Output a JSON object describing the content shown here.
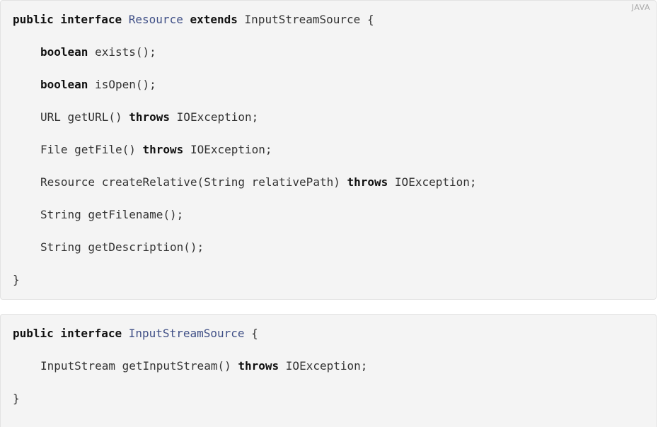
{
  "blocks": [
    {
      "language": "JAVA",
      "lines": [
        {
          "kw1": "public interface",
          "name": "Resource",
          "kw2": "extends",
          "rest": "InputStreamSource {"
        },
        {
          "kw": "boolean",
          "rest": "exists();"
        },
        {
          "kw": "boolean",
          "rest": "isOpen();"
        },
        {
          "pre": "URL getURL()",
          "kw": "throws",
          "rest": "IOException;"
        },
        {
          "pre": "File getFile()",
          "kw": "throws",
          "rest": "IOException;"
        },
        {
          "pre": "Resource createRelative(String relativePath)",
          "kw": "throws",
          "rest": "IOException;"
        },
        {
          "text": "String getFilename();"
        },
        {
          "text": "String getDescription();"
        },
        {
          "text": "}"
        }
      ]
    },
    {
      "lines": [
        {
          "kw1": "public interface",
          "name": "InputStreamSource",
          "rest": "{"
        },
        {
          "pre": "InputStream getInputStream()",
          "kw": "throws",
          "rest": "IOException;"
        },
        {
          "text": "}"
        }
      ]
    }
  ]
}
